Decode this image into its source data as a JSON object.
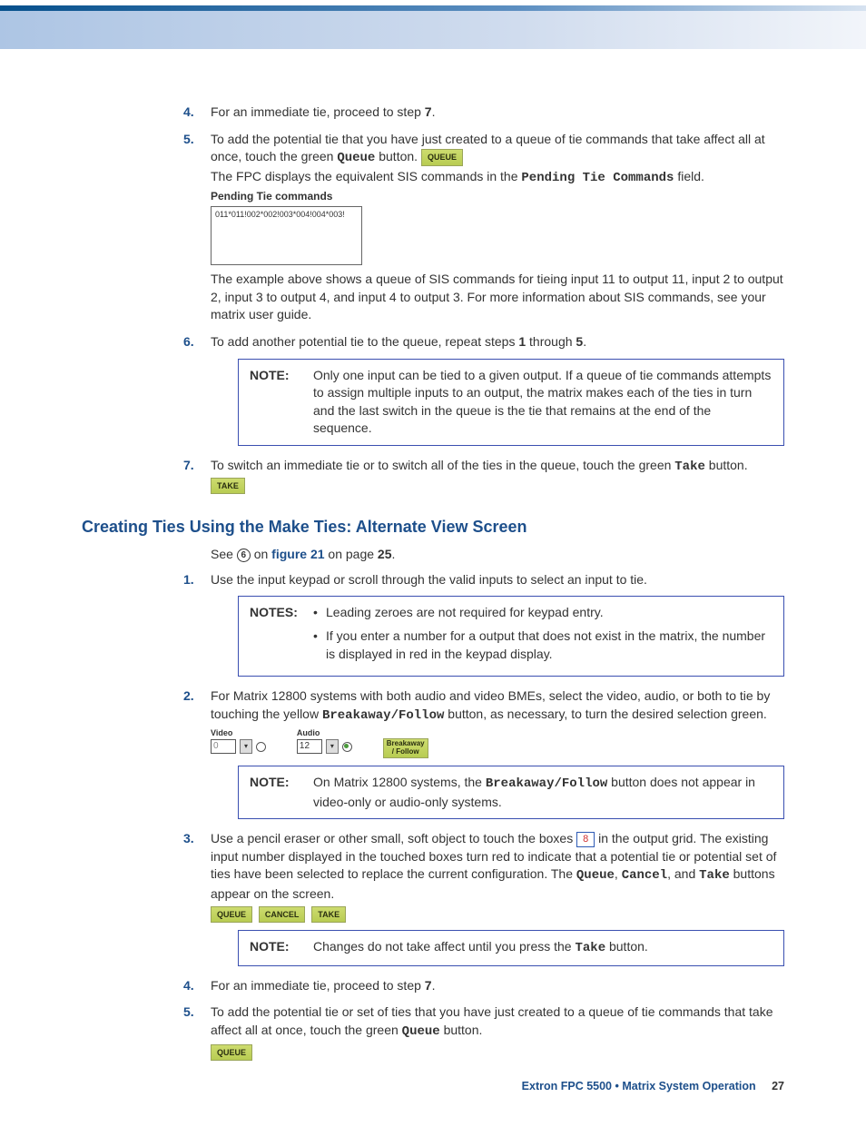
{
  "s4": {
    "num": "4.",
    "a": "For an immediate tie, proceed to step ",
    "b": "7",
    "c": "."
  },
  "s5": {
    "num": "5.",
    "a": "To add the potential tie that you have just created to a queue of tie commands that take affect all at once, touch the green ",
    "queue_word": "Queue",
    "b": " button. ",
    "btn": "QUEUE",
    "c": "The FPC displays the equivalent SIS commands in the ",
    "field": "Pending Tie Commands",
    "d": " field.",
    "pending_title": "Pending Tie commands",
    "pending_text": "011*011!002*002!003*004!004*003!",
    "e": "The example above shows a queue of SIS commands for tieing input 11 to output 11, input 2 to output 2, input 3 to output 4, and input 4 to output 3. For more information about SIS commands, see your matrix user guide."
  },
  "s6": {
    "num": "6.",
    "a": "To add another potential tie to the queue, repeat steps ",
    "b": "1",
    "c": " through ",
    "d": "5",
    "e": "."
  },
  "note1": {
    "label": "NOTE:",
    "body": "Only one input can be tied to a given output. If a queue of tie commands attempts to assign multiple inputs to an output, the matrix makes each of the ties in turn and the last switch in the queue is the tie that remains at the end of the sequence."
  },
  "s7": {
    "num": "7.",
    "a": "To switch an immediate tie or to switch all of the ties in the queue, touch the green ",
    "take": "Take",
    "b": " button. ",
    "btn": "TAKE"
  },
  "h2": "Creating Ties Using the Make Ties: Alternate View Screen",
  "see": {
    "a": "See ",
    "circ": "6",
    "b": " on ",
    "fig": "figure 21",
    "c": " on page ",
    "pg": "25",
    "d": "."
  },
  "b1": {
    "num": "1.",
    "a": "Use the input keypad or scroll through the valid inputs to select an input to tie."
  },
  "note2": {
    "label": "NOTES:",
    "i1": "Leading zeroes are not required for keypad entry.",
    "i2": "If you enter a number for a output that does not exist in the matrix, the number is displayed in red in the keypad display."
  },
  "b2": {
    "num": "2.",
    "a": "For Matrix 12800 systems with both audio and video BMEs, select the video, audio, or both to tie by touching the yellow ",
    "bf": "Breakaway/Follow",
    "b": " button, as necessary, to turn the desired selection green.",
    "video_lbl": "Video",
    "video_val": "0",
    "audio_lbl": "Audio",
    "audio_val": "12",
    "bf_btn": "Breakaway\n/ Follow"
  },
  "note3": {
    "label": "NOTE:",
    "a": "On Matrix 12800 systems, the ",
    "bf": "Breakaway/Follow",
    "b": " button does not appear in video-only or audio-only systems."
  },
  "b3": {
    "num": "3.",
    "a": "Use a pencil eraser or other small, soft object to touch the boxes ",
    "box": "8",
    "b": " in the output grid. The existing input number displayed in the touched boxes turn red to indicate that a potential tie or potential set of ties have been selected to replace the current configuration. The ",
    "w1": "Queue",
    "w2": "Cancel",
    "w3": "Take",
    "c": " buttons appear on the screen.",
    "btn1": "QUEUE",
    "btn2": "CANCEL",
    "btn3": "TAKE"
  },
  "note4": {
    "label": "NOTE:",
    "a": "Changes do not take affect until you press the ",
    "take": "Take",
    "b": " button."
  },
  "b4": {
    "num": "4.",
    "a": "For an immediate tie, proceed to step ",
    "b": "7",
    "c": "."
  },
  "b5": {
    "num": "5.",
    "a": "To add the potential tie or set of ties that you have just created to a queue of tie commands that take affect all at once, touch the green ",
    "q": "Queue",
    "b": " button.",
    "btn": "QUEUE"
  },
  "footer": {
    "prod": "Extron FPC 5500 • Matrix System Operation",
    "pg": "27"
  }
}
